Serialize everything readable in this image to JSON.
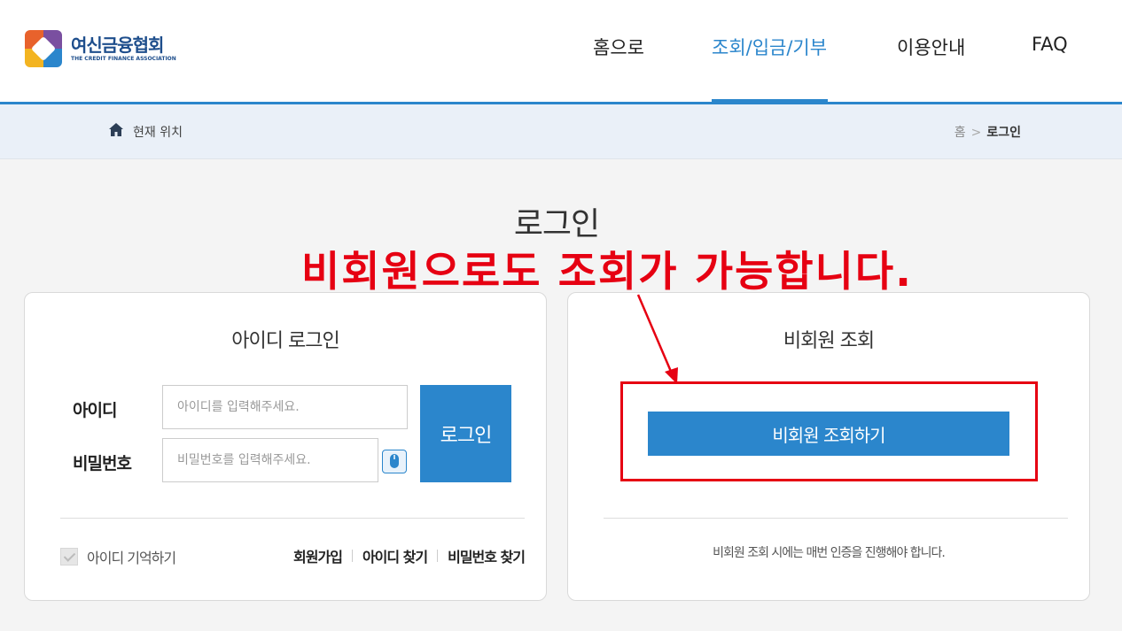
{
  "header": {
    "logo_ko": "여신금융협회",
    "logo_en": "THE CREDIT FINANCE ASSOCIATION",
    "nav": [
      {
        "label": "홈으로"
      },
      {
        "label": "조회/입금/기부",
        "active": true
      },
      {
        "label": "이용안내"
      },
      {
        "label": "FAQ"
      }
    ]
  },
  "breadcrumb": {
    "label": "현재 위치",
    "home": "홈",
    "separator": ">",
    "current": "로그인"
  },
  "page": {
    "title": "로그인",
    "notice": "비회원으로도 조회가 가능합니다."
  },
  "login_panel": {
    "title": "아이디 로그인",
    "id_label": "아이디",
    "id_placeholder": "아이디를 입력해주세요.",
    "pw_label": "비밀번호",
    "pw_placeholder": "비밀번호를 입력해주세요.",
    "login_button": "로그인",
    "remember_label": "아이디 기억하기",
    "remember_checked": true,
    "links": [
      "회원가입",
      "아이디 찾기",
      "비밀번호 찾기"
    ]
  },
  "guest_panel": {
    "title": "비회원 조회",
    "button": "비회원 조회하기",
    "note": "비회원 조회 시에는 매번 인증을 진행해야 합니다."
  },
  "colors": {
    "accent": "#2b86cc",
    "annotation": "#e60012",
    "brand": "#1e4e8c"
  }
}
